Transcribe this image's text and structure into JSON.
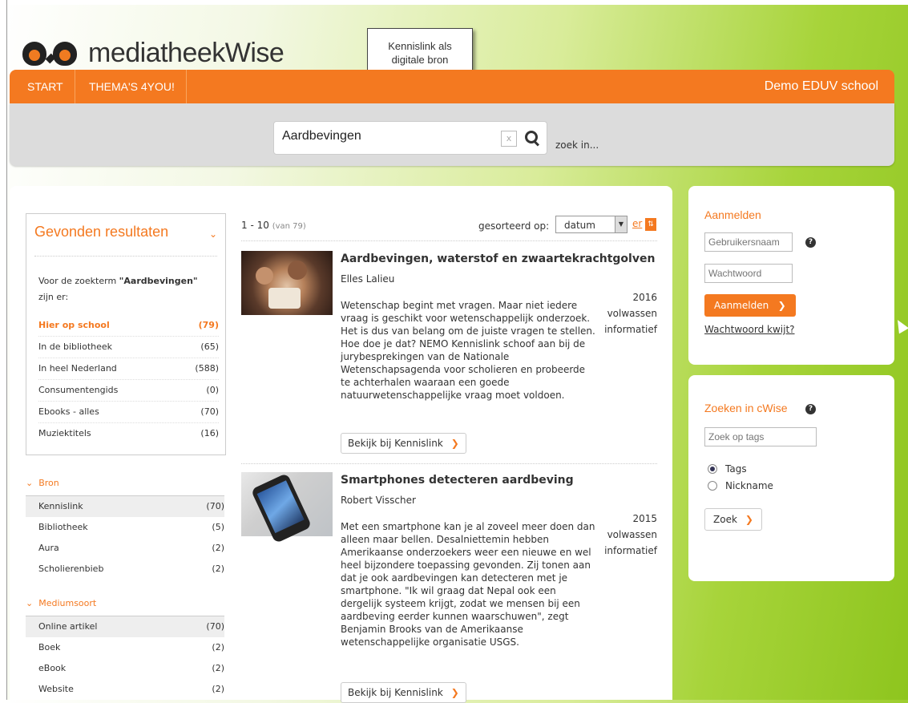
{
  "brand": {
    "name": "mediatheekWise"
  },
  "callout": {
    "line1": "Kennislink als",
    "line2": "digitale bron"
  },
  "nav": {
    "items": [
      "START",
      "THEMA'S 4YOU!"
    ],
    "school": "Demo EDUV school"
  },
  "search": {
    "value": "Aardbevingen",
    "clear": "x",
    "zoek_in": "zoek in..."
  },
  "results_box": {
    "title": "Gevonden resultaten",
    "intro_pre": "Voor de zoekterm ",
    "term": "\"Aardbevingen\"",
    "intro_post": "zijn er:",
    "rows": [
      {
        "label": "Hier op school",
        "count": "(79)"
      },
      {
        "label": "In de bibliotheek",
        "count": "(65)"
      },
      {
        "label": "In heel Nederland",
        "count": "(588)"
      },
      {
        "label": "Consumentengids",
        "count": "(0)"
      },
      {
        "label": "Ebooks - alles",
        "count": "(70)"
      },
      {
        "label": "Muziektitels",
        "count": "(16)"
      }
    ]
  },
  "facets": {
    "bron": {
      "title": "Bron",
      "rows": [
        {
          "label": "Kennislink",
          "count": "(70)"
        },
        {
          "label": "Bibliotheek",
          "count": "(5)"
        },
        {
          "label": "Aura",
          "count": "(2)"
        },
        {
          "label": "Scholierenbieb",
          "count": "(2)"
        }
      ]
    },
    "medium": {
      "title": "Mediumsoort",
      "rows": [
        {
          "label": "Online artikel",
          "count": "(70)"
        },
        {
          "label": "Boek",
          "count": "(2)"
        },
        {
          "label": "eBook",
          "count": "(2)"
        },
        {
          "label": "Website",
          "count": "(2)"
        }
      ]
    }
  },
  "listing": {
    "range": "1 - 10",
    "total": "(van 79)",
    "sort_label": "gesorteerd op:",
    "sort_value": "datum",
    "sort_link": "er"
  },
  "results": [
    {
      "title": "Aardbevingen, waterstof en zwaartekrachtgolven",
      "author": "Elles Lalieu",
      "year": "2016",
      "audience": "volwassen",
      "type": "informatief",
      "desc": "Wetenschap begint met vragen. Maar niet iedere vraag is geschikt voor wetenschappelijk onderzoek. Het is dus van belang om de juiste vragen te stellen. Hoe doe je dat? NEMO Kennislink schoof aan bij de jurybesprekingen van de Nationale Wetenschapsagenda voor scholieren en probeerde te achterhalen waaraan een goede natuurwetenschappelijke vraag moet voldoen.",
      "button": "Bekijk bij Kennislink"
    },
    {
      "title": "Smartphones detecteren aardbeving",
      "author": "Robert Visscher",
      "year": "2015",
      "audience": "volwassen",
      "type": "informatief",
      "desc": "Met een smartphone kan je al zoveel meer doen dan alleen maar bellen. Desalniettemin hebben Amerikaanse onderzoekers weer een nieuwe en wel heel bijzondere toepassing gevonden. Zij tonen aan dat je ook aardbevingen kan detecteren met je smartphone. \"Ik wil graag dat Nepal ook een dergelijk systeem krijgt, zodat we mensen bij een aardbeving eerder kunnen waarschuwen\", zegt Benjamin Brooks van de Amerikaanse wetenschappelijke organisatie USGS.",
      "button": "Bekijk bij Kennislink"
    }
  ],
  "login": {
    "title": "Aanmelden",
    "username_placeholder": "Gebruikersnaam",
    "password_placeholder": "Wachtwoord",
    "submit": "Aanmelden",
    "forgot": "Wachtwoord kwijt?"
  },
  "cwise": {
    "title": "Zoeken in cWise",
    "tags_placeholder": "Zoek op tags",
    "radio_tags": "Tags",
    "radio_nickname": "Nickname",
    "submit": "Zoek"
  },
  "colors": {
    "accent": "#f47920",
    "green": "#8ec51e"
  },
  "icons": {
    "search": "search-icon",
    "help": "help-icon",
    "arrow": "arrow-right-icon"
  }
}
